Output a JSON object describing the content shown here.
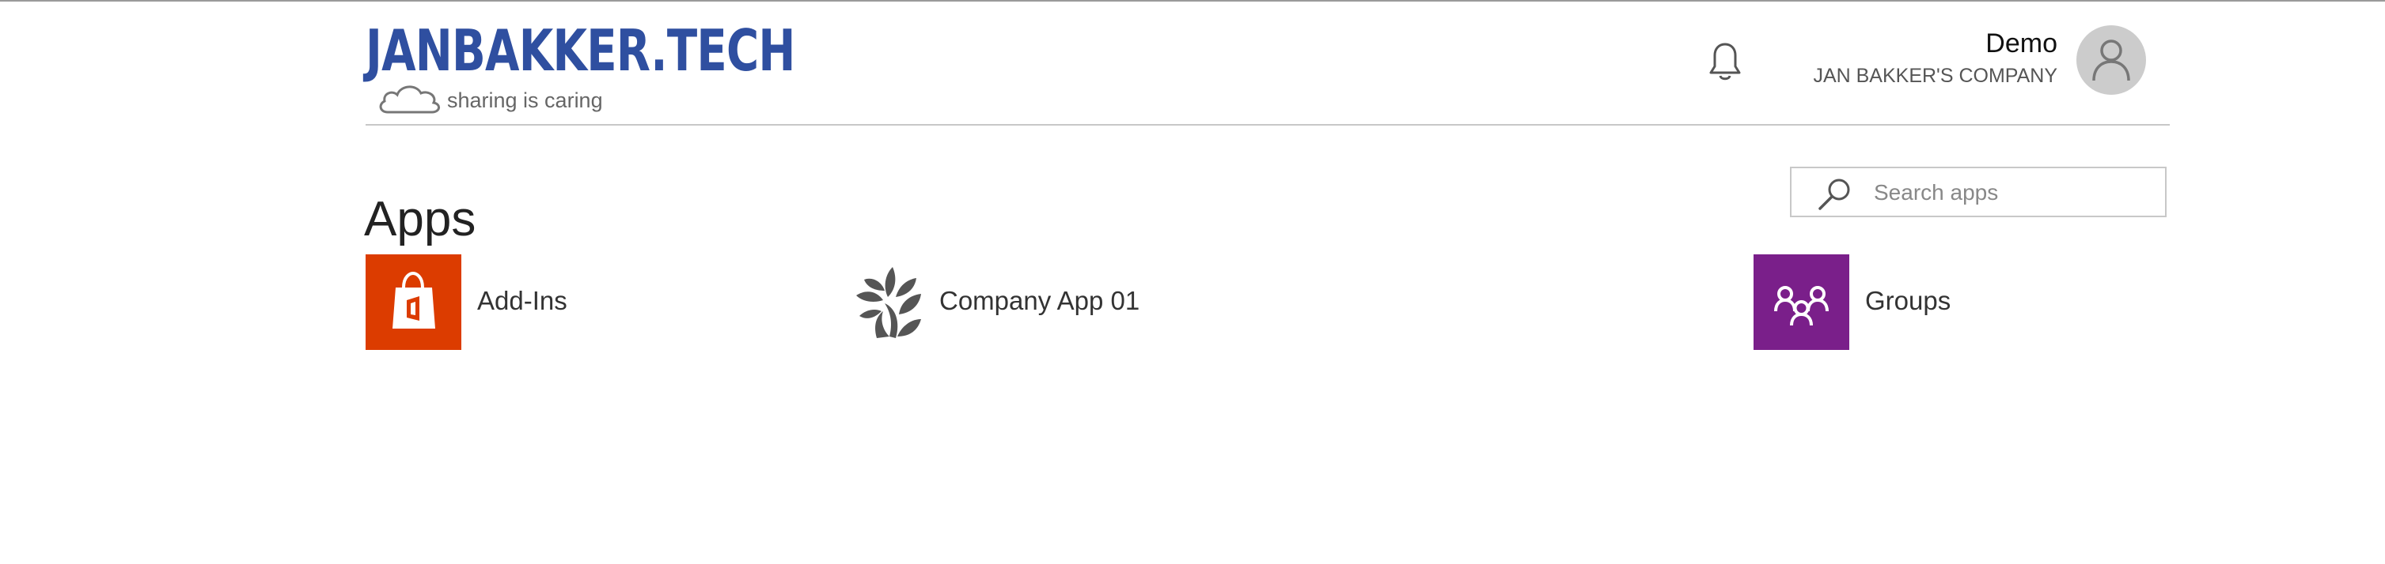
{
  "header": {
    "logo_title": "JANBAKKER.TECH",
    "logo_tagline": "sharing is caring",
    "logo_color": "#2f4fa0",
    "notification_icon": "bell-icon",
    "user": {
      "name": "Demo",
      "company": "JAN BAKKER'S COMPANY",
      "avatar_icon": "person-icon"
    }
  },
  "main": {
    "title": "Apps",
    "search": {
      "placeholder": "Search apps",
      "icon": "search-icon"
    },
    "apps": [
      {
        "label": "Add-Ins",
        "icon": "office-store-bag-icon",
        "color": "#dc3c00"
      },
      {
        "label": "Company App 01",
        "icon": "leaf-tree-icon",
        "color": "#555555"
      },
      {
        "label": "Groups",
        "icon": "groups-icon",
        "color": "#7a1f8a"
      }
    ]
  }
}
